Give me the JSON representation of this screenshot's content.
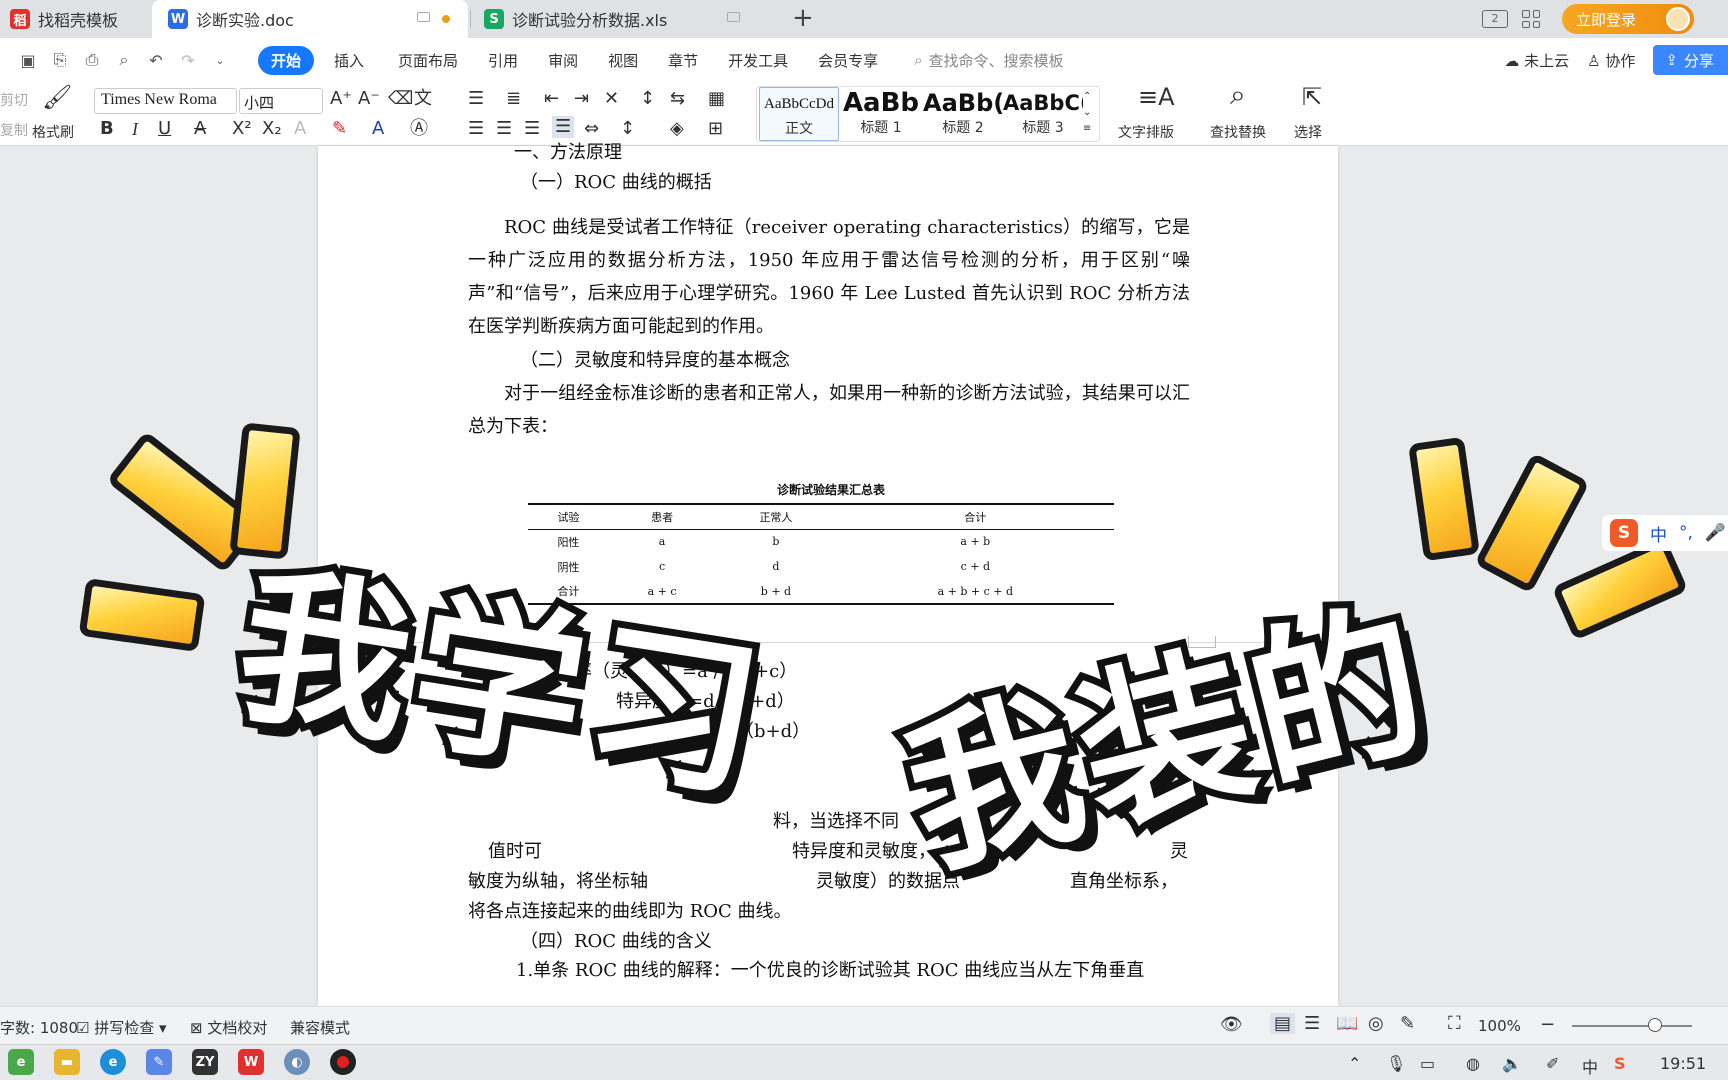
{
  "tabs": [
    {
      "label": "找稻壳模板",
      "icon": "docer-icon",
      "color": "#e0312f"
    },
    {
      "label": "诊断实验.doc",
      "icon": "wps-writer-icon",
      "color": "#2b6de5"
    },
    {
      "label": "诊断试验分析数据.xls",
      "icon": "wps-sheet-icon",
      "color": "#19a862"
    }
  ],
  "titlebar": {
    "login_label": "立即登录",
    "window_badge": "2"
  },
  "menu": {
    "items": [
      "开始",
      "插入",
      "页面布局",
      "引用",
      "审阅",
      "视图",
      "章节",
      "开发工具",
      "会员专享"
    ],
    "search_placeholder": "查找命令、搜索模板",
    "cloud": "未上云",
    "collab": "协作",
    "share": "分享"
  },
  "ribbon": {
    "cut": "剪切",
    "copy": "复制",
    "format_painter": "格式刷",
    "font_name": "Times New Roma",
    "font_size": "小四",
    "styles": [
      {
        "preview": "AaBbCcDd",
        "label": "正文"
      },
      {
        "preview": "AaBb",
        "label": "标题 1"
      },
      {
        "preview": "AaBb(",
        "label": "标题 2"
      },
      {
        "preview": "AaBbC(",
        "label": "标题 3"
      }
    ],
    "text_layout": "文字排版",
    "find_replace": "查找替换",
    "select": "选择"
  },
  "document": {
    "heading_1": "一、方法原理",
    "subheading_1": "（一）ROC 曲线的概括",
    "para_1": "ROC 曲线是受试者工作特征（receiver operating characteristics）的缩写，它是一种广泛应用的数据分析方法，1950 年应用于雷达信号检测的分析，用于区别“噪声”和“信号”，后来应用于心理学研究。1960 年 Lee Lusted  首先认识到 ROC 分析方法在医学判断疾病方面可能起到的作用。",
    "subheading_2": "（二）灵敏度和特异度的基本概念",
    "para_2": "对于一组经金标准诊断的患者和正常人，如果用一种新的诊断方法试验，其结果可以汇总为下表：",
    "table": {
      "caption": "诊断试验结果汇总表",
      "headers": [
        "试验",
        "患者",
        "正常人",
        "合计"
      ],
      "rows": [
        [
          "阳性",
          "a",
          "b",
          "a + b"
        ],
        [
          "阴性",
          "c",
          "d",
          "c + d"
        ],
        [
          "合计",
          "a + c",
          "b + d",
          "a + b + c + d"
        ]
      ]
    },
    "formula_1": "真阳性率（灵敏度）=a / （a+c）",
    "formula_2": "特异度）=d/（b+d）",
    "formula_3": "（b+d）",
    "frag_1": "料，当选择不同",
    "frag_2": "值时可",
    "frag_3": "特异度和灵敏度，",
    "frag_4": "灵",
    "frag_5": "敏度为纵轴，将坐标轴",
    "frag_6": "灵敏度）的数据点",
    "frag_7": "直角坐标系，",
    "frag_8": "将各点连接起来的曲线即为 ROC 曲线。",
    "subheading_4": "（四）ROC 曲线的含义",
    "para_4_start": "1.单条 ROC 曲线的解释：一个优良的诊断试验其 ROC 曲线应当从左下角垂直"
  },
  "overlay": {
    "left_text": "我学习",
    "right_text": "我装的"
  },
  "ime": {
    "mode": "中",
    "punct": "°,"
  },
  "statusbar": {
    "word_count": "字数: 1080",
    "spell_check": "拼写检查",
    "doc_proof": "文档校对",
    "compat_mode": "兼容模式",
    "zoom": "100%"
  },
  "taskbar": {
    "apps": [
      "edge-legacy-icon",
      "file-explorer-icon",
      "edge-icon",
      "notes-icon",
      "zy-app-icon",
      "wps-icon",
      "browser-icon",
      "recorder-icon"
    ],
    "tray_ime": "中",
    "clock": "19:51"
  }
}
